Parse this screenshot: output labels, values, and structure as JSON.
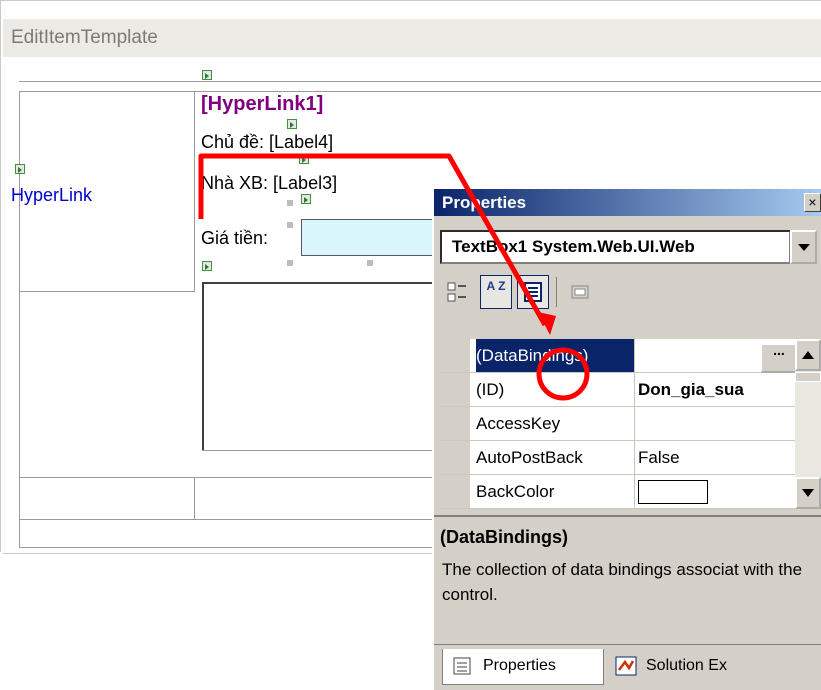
{
  "designer": {
    "template_title": "EditItemTemplate",
    "hyperlink_left": "HyperLink",
    "hyperlink1": "[HyperLink1]",
    "row_chude": "Chủ đề: [Label4]",
    "row_nhaxb": "Nhà XB: [Label3]",
    "row_giatien": "Giá tiền:"
  },
  "properties": {
    "title": "Properties",
    "close_glyph": "×",
    "object_selector": "TextBox1  System.Web.UI.Web",
    "toolbar": {
      "categorized_icon": "categorized-icon",
      "alphabetical_label": "A Z",
      "properties_icon": "properties-icon",
      "events_icon": "events-icon"
    },
    "rows": [
      {
        "name": "(DataBindings)",
        "value": "",
        "selected": true
      },
      {
        "name": "(ID)",
        "value": "Don_gia_sua",
        "selected": false
      },
      {
        "name": "AccessKey",
        "value": "",
        "selected": false
      },
      {
        "name": "AutoPostBack",
        "value": "False",
        "selected": false
      },
      {
        "name": "BackColor",
        "value": "",
        "selected": false
      }
    ],
    "ellipsis": "...",
    "description_title": "(DataBindings)",
    "description_text": "The collection of data bindings associat with the control.",
    "tabs": [
      {
        "label": "Properties",
        "active": true
      },
      {
        "label": "Solution Ex",
        "active": false
      }
    ]
  },
  "colors": {
    "title_blue": "#0a246a",
    "hyperlink_purple": "#800080",
    "hyperlink_blue": "#0000cc",
    "textbox_fill": "#d9f6fc",
    "annotation_red": "#ff0000"
  }
}
